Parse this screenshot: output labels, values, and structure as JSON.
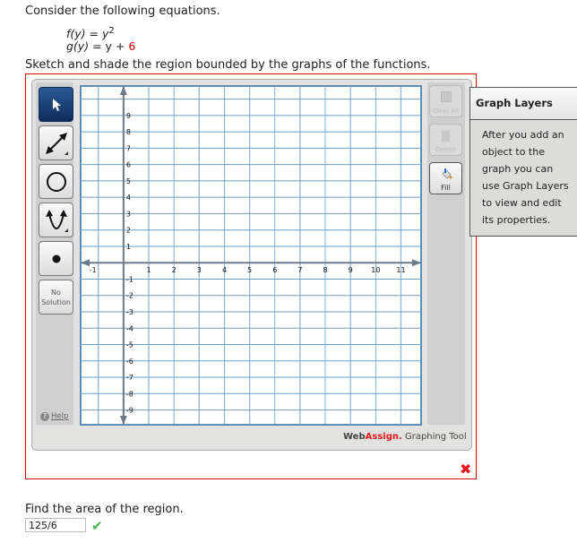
{
  "question": {
    "intro": "Consider the following equations.",
    "f_lhs": "f(y)",
    "f_rhs_base": "y",
    "f_rhs_exp": "2",
    "g_lhs": "g(y)",
    "g_rhs": "y + ",
    "g_const": "6",
    "instruction": "Sketch and shade the region bounded by the graphs of the functions."
  },
  "tools": {
    "left": [
      {
        "name": "pointer",
        "icon": "arrow-pointer-icon",
        "selected": true
      },
      {
        "name": "line",
        "icon": "double-arrow-line-icon"
      },
      {
        "name": "circle",
        "icon": "circle-icon"
      },
      {
        "name": "parabola",
        "icon": "parabola-icon"
      },
      {
        "name": "point",
        "icon": "point-icon"
      }
    ],
    "no_solution": "No Solution",
    "help": "Help",
    "clear_all": "Clear All",
    "delete": "Delete",
    "fill": "Fill"
  },
  "graph": {
    "x_range": [
      -1.7,
      11.8
    ],
    "y_range": [
      -9.9,
      10.8
    ],
    "x_ticks": [
      -1,
      1,
      2,
      3,
      4,
      5,
      6,
      7,
      8,
      9,
      10,
      11
    ],
    "y_ticks": [
      9,
      8,
      7,
      6,
      5,
      4,
      3,
      2,
      1,
      -1,
      -2,
      -3,
      -4,
      -5,
      -6,
      -7,
      -8,
      -9
    ],
    "grid_color": "#6a9ec9",
    "axis_color": "#6b7a88"
  },
  "branding": {
    "web": "Web",
    "assign": "Assign.",
    "suffix": " Graphing Tool"
  },
  "layers": {
    "title": "Graph Layers",
    "body": [
      "After you add an object to the graph you",
      "can use Graph Layers to view and edit its",
      "properties."
    ]
  },
  "status": {
    "graph_incorrect": "incorrect-x-icon",
    "answer_correct": "checkmark-icon"
  },
  "area_question": {
    "prompt": "Find the area of the region.",
    "answer": "125/6"
  },
  "colors": {
    "error": "#e00000",
    "correct": "#4caf50",
    "accent_red": "#e8141c"
  }
}
